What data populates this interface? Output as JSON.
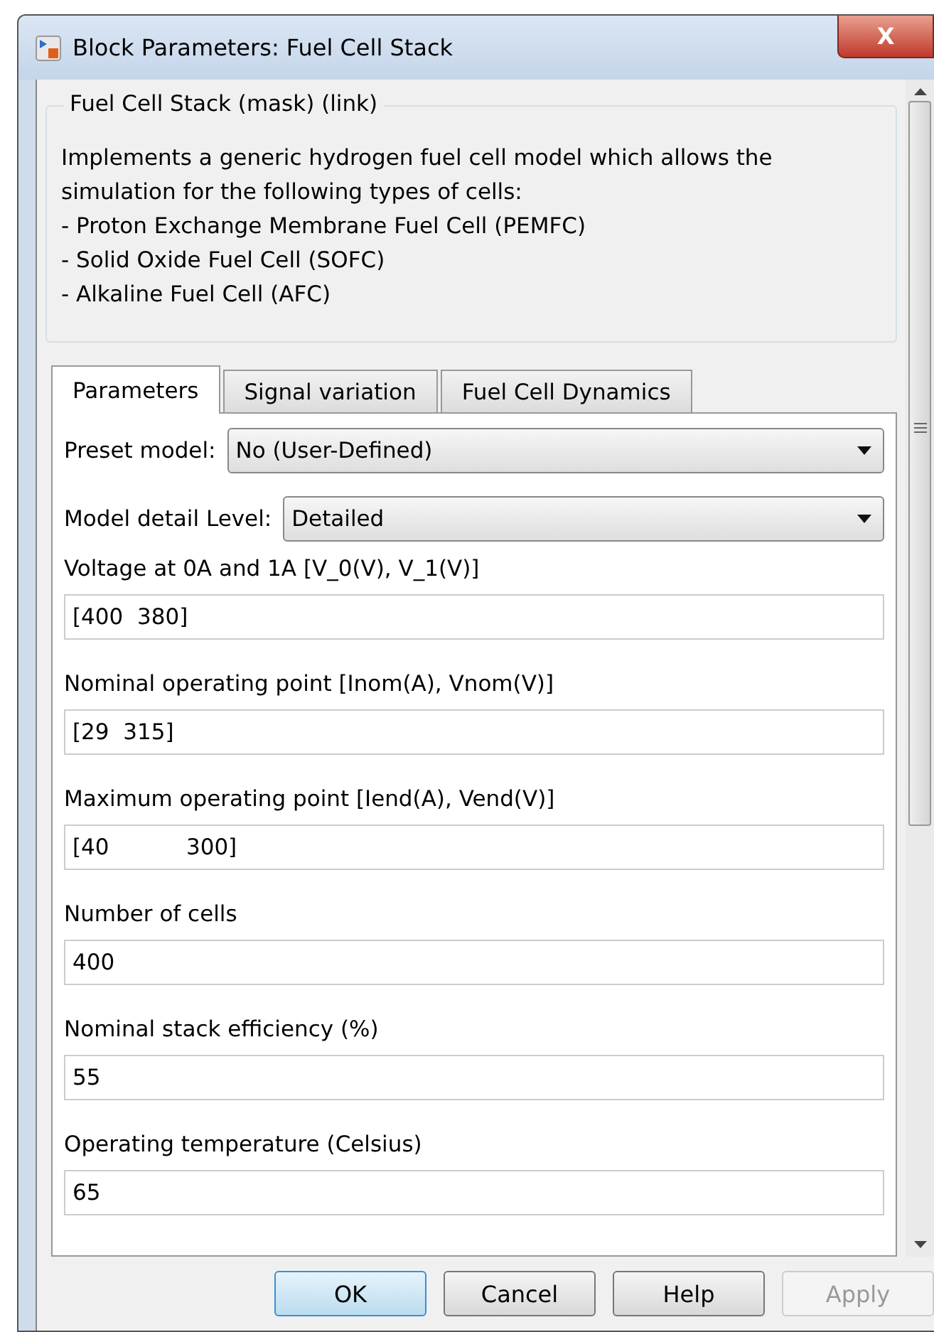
{
  "window": {
    "title": "Block Parameters: Fuel Cell Stack",
    "close_label": "X"
  },
  "description": {
    "title": "Fuel Cell Stack (mask) (link)",
    "lines": [
      "Implements a generic hydrogen fuel cell model which allows the simulation for the following types of cells:",
      "- Proton Exchange Membrane Fuel Cell (PEMFC)",
      "- Solid Oxide Fuel Cell (SOFC)",
      "- Alkaline Fuel Cell (AFC)"
    ]
  },
  "tabs": [
    {
      "label": "Parameters",
      "selected": true
    },
    {
      "label": "Signal variation",
      "selected": false
    },
    {
      "label": "Fuel Cell Dynamics",
      "selected": false
    }
  ],
  "parameters": [
    {
      "kind": "dropdown",
      "label": "Preset model:",
      "value": "No (User-Defined)"
    },
    {
      "kind": "dropdown",
      "label": "Model detail Level:",
      "value": "Detailed"
    },
    {
      "kind": "text",
      "label": "Voltage at 0A and 1A [V_0(V), V_1(V)]",
      "value": "[400  380]"
    },
    {
      "kind": "text",
      "label": "Nominal operating point [Inom(A), Vnom(V)]",
      "value": "[29  315]"
    },
    {
      "kind": "text",
      "label": "Maximum operating point [Iend(A), Vend(V)]",
      "value": "[40           300]"
    },
    {
      "kind": "text",
      "label": "Number of cells",
      "value": "400"
    },
    {
      "kind": "text",
      "label": "Nominal stack efficiency (%)",
      "value": "55"
    },
    {
      "kind": "text",
      "label": "Operating temperature (Celsius)",
      "value": "65"
    }
  ],
  "buttons": [
    {
      "label": "OK",
      "default": true,
      "disabled": false
    },
    {
      "label": "Cancel",
      "default": false,
      "disabled": false
    },
    {
      "label": "Help",
      "default": false,
      "disabled": false
    },
    {
      "label": "Apply",
      "default": false,
      "disabled": true
    }
  ]
}
